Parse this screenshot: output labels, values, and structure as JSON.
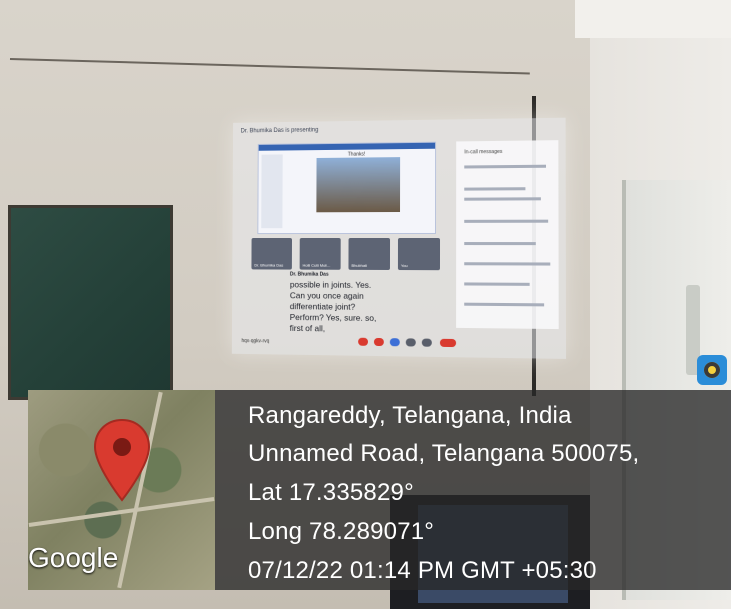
{
  "photo": {
    "projection": {
      "presenting_text": "Dr. Bhumika Das is presenting",
      "slide_title": "Thanks!",
      "chat_title": "In-call messages",
      "tiles": [
        "Dr. Bhumika Das",
        "Holli Csiti Moli...",
        "Bhubhati",
        "You"
      ],
      "speaker_name": "Dr. Bhumika Das",
      "caption": "possible in joints. Yes. Can you once again differentiate joint? Perform? Yes, sure. so, first of all,",
      "meeting_code": "hqx-qgkv-rvq"
    }
  },
  "geotag": {
    "location": "Rangareddy, Telangana, India",
    "address": "Unnamed Road, Telangana 500075,",
    "lat": "Lat 17.335829°",
    "long": "Long 78.289071°",
    "datetime": "07/12/22 01:14 PM GMT +05:30",
    "map_brand": "Google"
  },
  "colors": {
    "pin": "#d93a2f",
    "overlay": "#282828",
    "text": "#ffffff"
  },
  "icons": [
    "map-pin-icon",
    "camera-app-icon"
  ]
}
